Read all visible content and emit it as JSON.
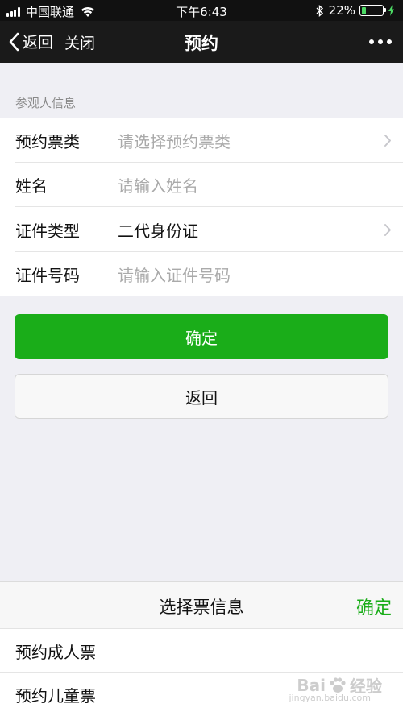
{
  "status_bar": {
    "carrier": "中国联通",
    "time": "下午6:43",
    "battery_percent": "22%",
    "battery_level": 0.22
  },
  "nav": {
    "back_label": "返回",
    "close_label": "关闭",
    "title": "预约"
  },
  "form": {
    "section_label": "参观人信息",
    "rows": [
      {
        "label": "预约票类",
        "placeholder": "请选择预约票类",
        "has_chevron": true
      },
      {
        "label": "姓名",
        "placeholder": "请输入姓名",
        "has_chevron": false
      },
      {
        "label": "证件类型",
        "value": "二代身份证",
        "has_chevron": true
      },
      {
        "label": "证件号码",
        "placeholder": "请输入证件号码",
        "has_chevron": false
      }
    ]
  },
  "buttons": {
    "confirm_label": "确定",
    "back_label": "返回"
  },
  "picker": {
    "title": "选择票信息",
    "confirm_label": "确定",
    "options": [
      "预约成人票",
      "预约儿童票"
    ]
  },
  "watermark": {
    "text_left": "Bai",
    "text_right": "经验",
    "sub": "jingyan.baidu.com"
  },
  "colors": {
    "accent_green": "#1aad19",
    "nav_bg": "#1a1a1a",
    "page_bg": "#efeff4"
  }
}
